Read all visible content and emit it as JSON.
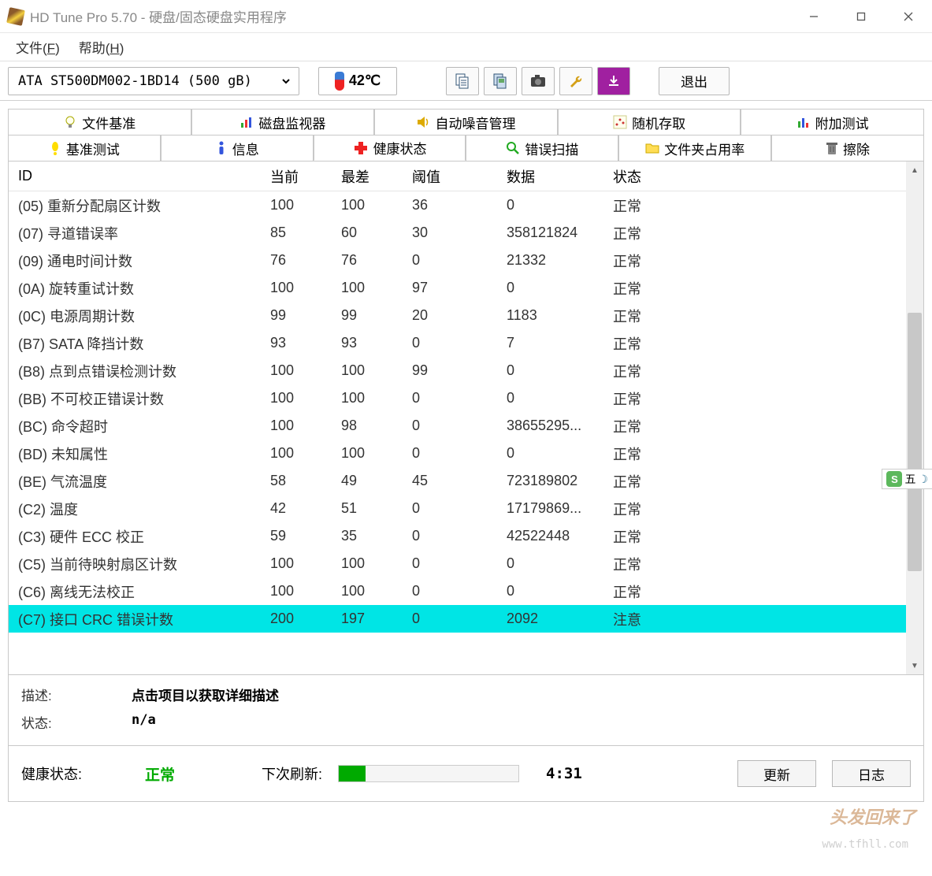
{
  "window": {
    "title": "HD Tune Pro 5.70 - 硬盘/固态硬盘实用程序"
  },
  "menu": {
    "file": "文件(F)",
    "help": "帮助(H)"
  },
  "toolbar": {
    "drive": "ATA     ST500DM002-1BD14 (500 gB)",
    "temperature": "42℃",
    "exit": "退出"
  },
  "tabs_row1": [
    {
      "label": "文件基准"
    },
    {
      "label": "磁盘监视器"
    },
    {
      "label": "自动噪音管理"
    },
    {
      "label": "随机存取"
    },
    {
      "label": "附加测试"
    }
  ],
  "tabs_row2": [
    {
      "label": "基准测试"
    },
    {
      "label": "信息"
    },
    {
      "label": "健康状态",
      "active": true
    },
    {
      "label": "错误扫描"
    },
    {
      "label": "文件夹占用率"
    },
    {
      "label": "擦除"
    }
  ],
  "table": {
    "headers": {
      "id": "ID",
      "current": "当前",
      "worst": "最差",
      "threshold": "阈值",
      "data": "数据",
      "status": "状态"
    },
    "rows": [
      {
        "id": "(05) 重新分配扇区计数",
        "cur": "100",
        "worst": "100",
        "thr": "36",
        "data": "0",
        "status": "正常"
      },
      {
        "id": "(07) 寻道错误率",
        "cur": "85",
        "worst": "60",
        "thr": "30",
        "data": "358121824",
        "status": "正常"
      },
      {
        "id": "(09) 通电时间计数",
        "cur": "76",
        "worst": "76",
        "thr": "0",
        "data": "21332",
        "status": "正常"
      },
      {
        "id": "(0A) 旋转重试计数",
        "cur": "100",
        "worst": "100",
        "thr": "97",
        "data": "0",
        "status": "正常"
      },
      {
        "id": "(0C) 电源周期计数",
        "cur": "99",
        "worst": "99",
        "thr": "20",
        "data": "1183",
        "status": "正常"
      },
      {
        "id": "(B7) SATA 降挡计数",
        "cur": "93",
        "worst": "93",
        "thr": "0",
        "data": "7",
        "status": "正常"
      },
      {
        "id": "(B8) 点到点错误检测计数",
        "cur": "100",
        "worst": "100",
        "thr": "99",
        "data": "0",
        "status": "正常"
      },
      {
        "id": "(BB) 不可校正错误计数",
        "cur": "100",
        "worst": "100",
        "thr": "0",
        "data": "0",
        "status": "正常"
      },
      {
        "id": "(BC) 命令超时",
        "cur": "100",
        "worst": "98",
        "thr": "0",
        "data": "38655295...",
        "status": "正常"
      },
      {
        "id": "(BD) 未知属性",
        "cur": "100",
        "worst": "100",
        "thr": "0",
        "data": "0",
        "status": "正常"
      },
      {
        "id": "(BE) 气流温度",
        "cur": "58",
        "worst": "49",
        "thr": "45",
        "data": "723189802",
        "status": "正常"
      },
      {
        "id": "(C2) 温度",
        "cur": "42",
        "worst": "51",
        "thr": "0",
        "data": "17179869...",
        "status": "正常"
      },
      {
        "id": "(C3) 硬件 ECC 校正",
        "cur": "59",
        "worst": "35",
        "thr": "0",
        "data": "42522448",
        "status": "正常"
      },
      {
        "id": "(C5) 当前待映射扇区计数",
        "cur": "100",
        "worst": "100",
        "thr": "0",
        "data": "0",
        "status": "正常"
      },
      {
        "id": "(C6) 离线无法校正",
        "cur": "100",
        "worst": "100",
        "thr": "0",
        "data": "0",
        "status": "正常"
      },
      {
        "id": "(C7) 接口 CRC 错误计数",
        "cur": "200",
        "worst": "197",
        "thr": "0",
        "data": "2092",
        "status": "注意",
        "highlight": true
      }
    ]
  },
  "detail": {
    "desc_label": "描述:",
    "desc_value": "点击项目以获取详细描述",
    "status_label": "状态:",
    "status_value": "n/a"
  },
  "footer": {
    "health_label": "健康状态:",
    "health_value": "正常",
    "refresh_label": "下次刷新:",
    "countdown": "4:31",
    "update_btn": "更新",
    "log_btn": "日志"
  },
  "ime": {
    "label": "五"
  },
  "watermark": {
    "text": "头发回来了",
    "url": "www.tfhll.com"
  }
}
